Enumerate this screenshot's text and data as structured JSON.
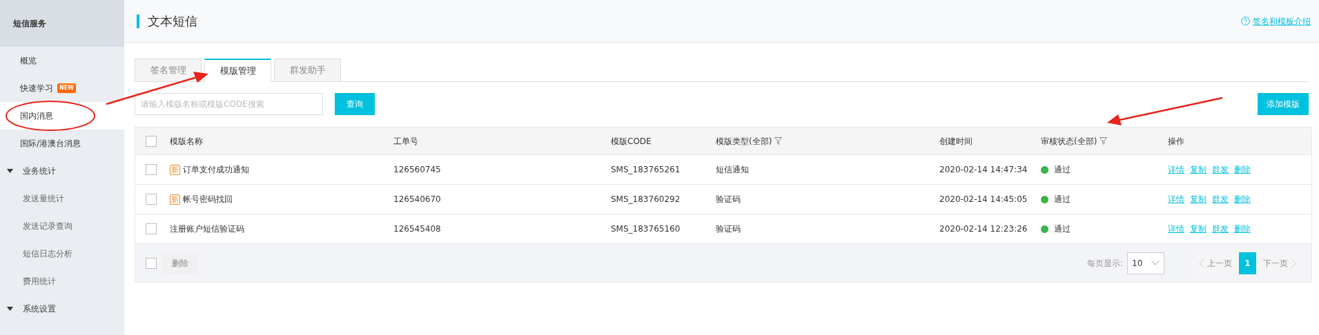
{
  "sidebar": {
    "title": "短信服务",
    "items": [
      {
        "kind": "link",
        "label": "概览",
        "selected": false
      },
      {
        "kind": "link",
        "label": "快速学习",
        "badge": "NEW",
        "selected": false
      },
      {
        "kind": "link",
        "label": "国内消息",
        "selected": true
      },
      {
        "kind": "link",
        "label": "国际/港澳台消息",
        "selected": false
      },
      {
        "kind": "group",
        "label": "业务统计",
        "expanded": true,
        "children": [
          {
            "label": "发送量统计",
            "selected": false
          },
          {
            "label": "发送记录查询",
            "selected": false
          },
          {
            "label": "短信日志分析",
            "selected": false
          },
          {
            "label": "费用统计",
            "selected": false
          }
        ]
      },
      {
        "kind": "group",
        "label": "系统设置",
        "expanded": true
      }
    ]
  },
  "header": {
    "title": "文本短信",
    "help_link": "签名和模板介绍"
  },
  "tabs": [
    {
      "label": "签名管理",
      "selected": false
    },
    {
      "label": "模版管理",
      "selected": true
    },
    {
      "label": "群发助手",
      "selected": false
    }
  ],
  "search": {
    "placeholder": "请输入模版名称或模版CODE搜索",
    "button": "查询"
  },
  "add_button": "添加模版",
  "table": {
    "select_all_checked": false,
    "columns": [
      {
        "label": "模版名称",
        "filter": false
      },
      {
        "label": "工单号",
        "filter": false
      },
      {
        "label": "模版CODE",
        "filter": false
      },
      {
        "label": "模版类型(全部)",
        "filter": true
      },
      {
        "label": "创建时间",
        "filter": false
      },
      {
        "label": "审核状态(全部)",
        "filter": true
      },
      {
        "label": "操作",
        "filter": false
      }
    ],
    "rows": [
      {
        "checked": false,
        "tag": "新",
        "name": "订单支付成功通知",
        "ticket": "126560745",
        "code": "SMS_183765261",
        "type": "短信通知",
        "created": "2020-02-14 14:47:34",
        "status": "通过",
        "actions": [
          "详情",
          "复制",
          "群发",
          "删除"
        ]
      },
      {
        "checked": false,
        "tag": "新",
        "name": "帐号密码找回",
        "ticket": "126540670",
        "code": "SMS_183760292",
        "type": "验证码",
        "created": "2020-02-14 14:45:05",
        "status": "通过",
        "actions": [
          "详情",
          "复制",
          "群发",
          "删除"
        ]
      },
      {
        "checked": false,
        "name": "注册账户短信验证码",
        "ticket": "126545408",
        "code": "SMS_183765160",
        "type": "验证码",
        "created": "2020-02-14 12:23:26",
        "status": "通过",
        "actions": [
          "详情",
          "复制",
          "群发",
          "删除"
        ]
      }
    ]
  },
  "footer": {
    "select_all_checked": false,
    "delete_button": "删除",
    "delete_disabled": true,
    "page_size_label": "每页显示:",
    "page_size": "10",
    "prev": "上一页",
    "prev_disabled": true,
    "pages": [
      {
        "label": "1",
        "selected": true
      }
    ],
    "next": "下一页",
    "next_disabled": true
  }
}
